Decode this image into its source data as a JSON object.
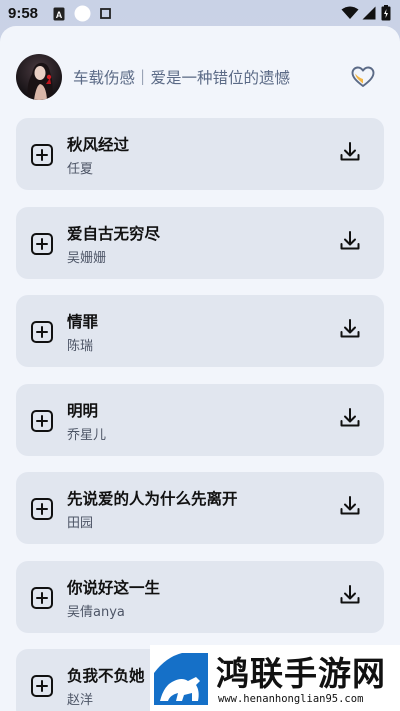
{
  "status_bar": {
    "time": "9:58",
    "icons": [
      "notification-a-icon",
      "circle-icon",
      "square-icon",
      "wifi-icon",
      "signal-icon",
      "battery-icon"
    ]
  },
  "playlist": {
    "title": "车载伤感｜爱是一种错位的遗憾",
    "avatar": "avatar-image",
    "favorite_icon": "heart-icon"
  },
  "songs": [
    {
      "title": "秋风经过",
      "artist": "任夏"
    },
    {
      "title": "爱自古无穷尽",
      "artist": "吴姗姗"
    },
    {
      "title": "情罪",
      "artist": "陈瑞"
    },
    {
      "title": "明明",
      "artist": "乔星儿"
    },
    {
      "title": "先说爱的人为什么先离开",
      "artist": "田园"
    },
    {
      "title": "你说好这一生",
      "artist": "吴倩anya"
    },
    {
      "title": "负我不负她",
      "artist": "赵洋"
    }
  ],
  "watermark": {
    "title": "鸿联手游网",
    "url": "www.henanhonglian95.com"
  },
  "colors": {
    "background": "#f2f5fb",
    "card": "#e1e6ef",
    "title_text": "#5b6a86",
    "accent_heart": "#f2b544"
  }
}
